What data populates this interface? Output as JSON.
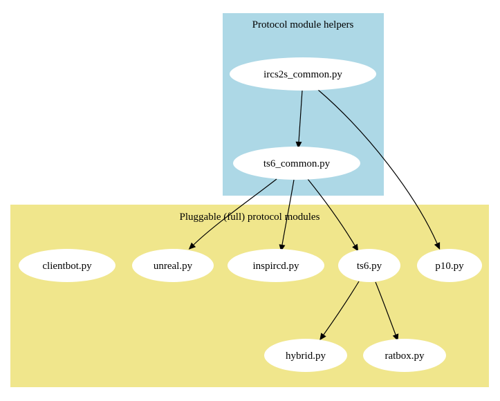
{
  "colors": {
    "helpers_cluster": "#add8e6",
    "modules_cluster": "#f0e68c",
    "node_fill": "#ffffff",
    "edge": "#000000"
  },
  "clusters": {
    "helpers": {
      "label": "Protocol module helpers"
    },
    "modules": {
      "label": "Pluggable (full) protocol modules"
    }
  },
  "nodes": {
    "ircs2s_common": {
      "label": "ircs2s_common.py"
    },
    "ts6_common": {
      "label": "ts6_common.py"
    },
    "clientbot": {
      "label": "clientbot.py"
    },
    "unreal": {
      "label": "unreal.py"
    },
    "inspircd": {
      "label": "inspircd.py"
    },
    "ts6": {
      "label": "ts6.py"
    },
    "p10": {
      "label": "p10.py"
    },
    "hybrid": {
      "label": "hybrid.py"
    },
    "ratbox": {
      "label": "ratbox.py"
    }
  },
  "edges": [
    {
      "from": "ircs2s_common",
      "to": "ts6_common"
    },
    {
      "from": "ircs2s_common",
      "to": "p10"
    },
    {
      "from": "ts6_common",
      "to": "unreal"
    },
    {
      "from": "ts6_common",
      "to": "inspircd"
    },
    {
      "from": "ts6_common",
      "to": "ts6"
    },
    {
      "from": "ts6",
      "to": "hybrid"
    },
    {
      "from": "ts6",
      "to": "ratbox"
    }
  ]
}
